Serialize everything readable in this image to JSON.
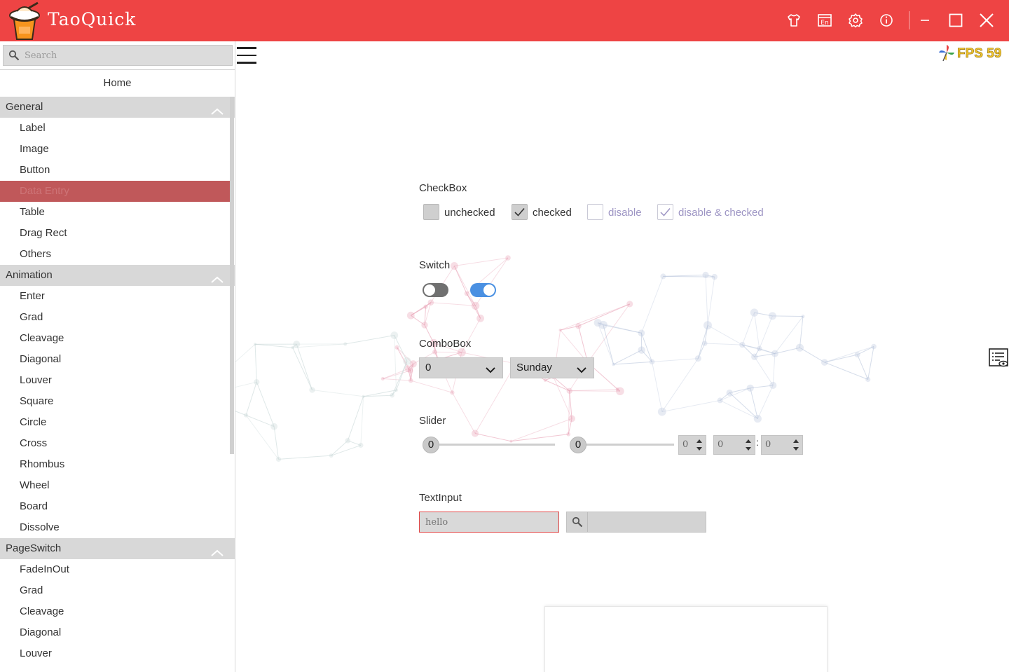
{
  "app": {
    "title": "TaoQuick",
    "accent_color": "#ee4444",
    "toolbar_icons": [
      "skin-icon",
      "language-icon",
      "settings-icon",
      "info-icon"
    ],
    "language_badge": "En",
    "window_controls": [
      "minimize-icon",
      "maximize-icon",
      "close-icon"
    ]
  },
  "sidebar": {
    "search_placeholder": "Search",
    "home_label": "Home",
    "groups": [
      {
        "label": "General",
        "items": [
          "Label",
          "Image",
          "Button",
          "Data Entry",
          "Table",
          "Drag Rect",
          "Others"
        ]
      },
      {
        "label": "Animation",
        "items": [
          "Enter",
          "Grad",
          "Cleavage",
          "Diagonal",
          "Louver",
          "Square",
          "Circle",
          "Cross",
          "Rhombus",
          "Wheel",
          "Board",
          "Dissolve"
        ]
      },
      {
        "label": "PageSwitch",
        "items": [
          "FadeInOut",
          "Grad",
          "Cleavage",
          "Diagonal",
          "Louver"
        ]
      }
    ],
    "selected_item": "Data Entry"
  },
  "main": {
    "fps_label": "FPS 59",
    "checkbox": {
      "title": "CheckBox",
      "items": [
        {
          "label": "unchecked",
          "checked": false,
          "enabled": true
        },
        {
          "label": "checked",
          "checked": true,
          "enabled": true
        },
        {
          "label": "disable",
          "checked": false,
          "enabled": false
        },
        {
          "label": "disable & checked",
          "checked": true,
          "enabled": false
        }
      ]
    },
    "switch": {
      "title": "Switch",
      "items": [
        {
          "on": false,
          "color": "#707070"
        },
        {
          "on": true,
          "color": "#4a90e2"
        }
      ]
    },
    "combobox": {
      "title": "ComboBox",
      "items": [
        {
          "value": "0"
        },
        {
          "value": "Sunday"
        }
      ]
    },
    "slider": {
      "title": "Slider",
      "sliders": [
        {
          "value": "0"
        },
        {
          "value": "0"
        }
      ],
      "spinboxes": [
        "0",
        "0",
        "0"
      ],
      "separator": ":"
    },
    "textinput": {
      "title": "TextInput",
      "text_placeholder": "hello",
      "search_value": ""
    }
  }
}
